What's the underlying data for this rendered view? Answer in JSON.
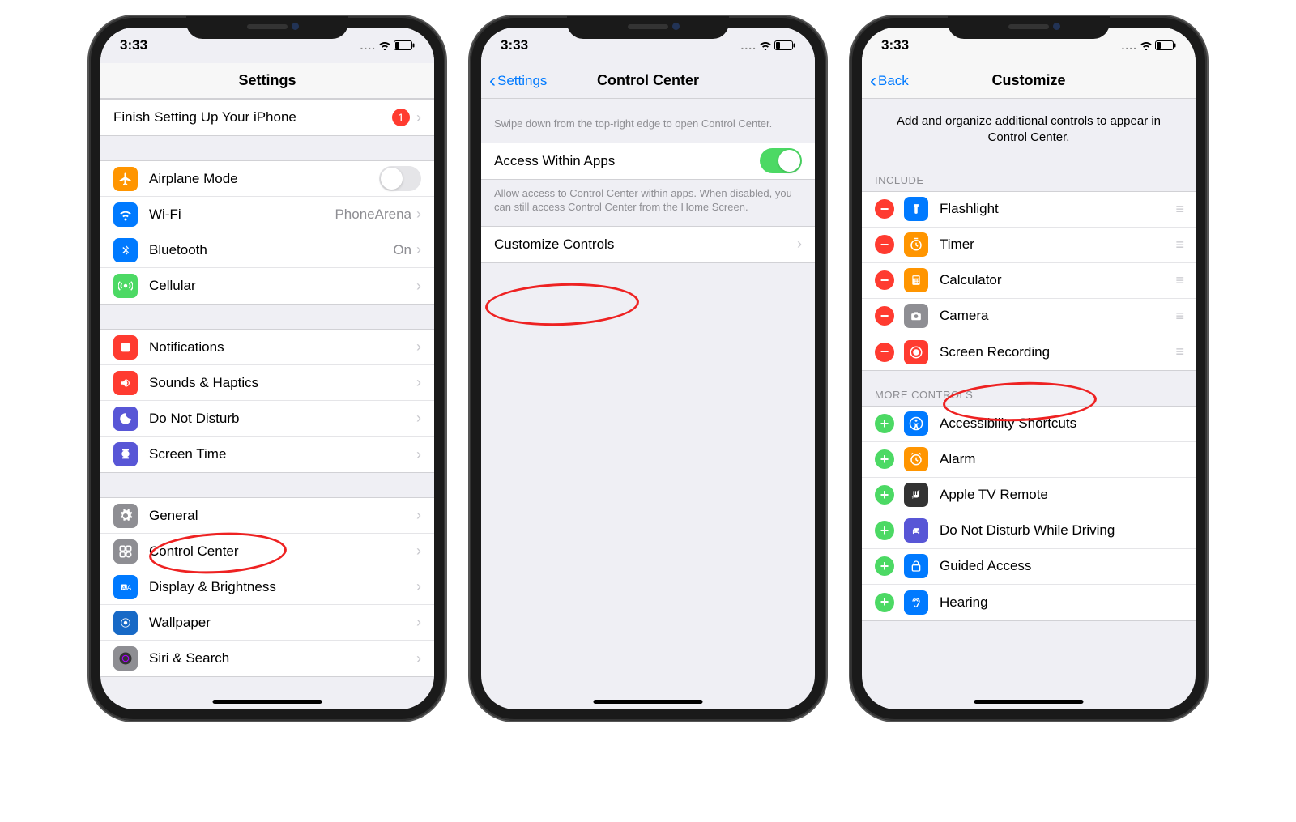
{
  "status": {
    "time": "3:33",
    "dots": "....",
    "wifi": "wifi",
    "battery": "low"
  },
  "screen1": {
    "title": "Settings",
    "setup": {
      "label": "Finish Setting Up Your iPhone",
      "badge": "1"
    },
    "group1": [
      {
        "label": "Airplane Mode",
        "iconBg": "bg-orange",
        "type": "toggle",
        "on": false
      },
      {
        "label": "Wi-Fi",
        "value": "PhoneArena",
        "iconBg": "bg-blue",
        "type": "link"
      },
      {
        "label": "Bluetooth",
        "value": "On",
        "iconBg": "bg-blue",
        "type": "link"
      },
      {
        "label": "Cellular",
        "iconBg": "bg-green",
        "type": "link"
      }
    ],
    "group2": [
      {
        "label": "Notifications",
        "iconBg": "bg-red",
        "type": "link"
      },
      {
        "label": "Sounds & Haptics",
        "iconBg": "bg-red",
        "type": "link"
      },
      {
        "label": "Do Not Disturb",
        "iconBg": "bg-purple",
        "type": "link"
      },
      {
        "label": "Screen Time",
        "iconBg": "bg-purple",
        "type": "link"
      }
    ],
    "group3": [
      {
        "label": "General",
        "iconBg": "bg-gray",
        "type": "link"
      },
      {
        "label": "Control Center",
        "iconBg": "bg-gray",
        "type": "link"
      },
      {
        "label": "Display & Brightness",
        "iconBg": "bg-blue",
        "type": "link"
      },
      {
        "label": "Wallpaper",
        "iconBg": "bg-darkblue",
        "type": "link"
      },
      {
        "label": "Siri & Search",
        "iconBg": "bg-gray",
        "type": "link"
      }
    ]
  },
  "screen2": {
    "back": "Settings",
    "title": "Control Center",
    "help1": "Swipe down from the top-right edge to open Control Center.",
    "access": {
      "label": "Access Within Apps",
      "on": true
    },
    "help2": "Allow access to Control Center within apps. When disabled, you can still access Control Center from the Home Screen.",
    "customize": "Customize Controls"
  },
  "screen3": {
    "back": "Back",
    "title": "Customize",
    "desc": "Add and organize additional controls to appear in Control Center.",
    "includeHeader": "INCLUDE",
    "include": [
      {
        "label": "Flashlight",
        "iconBg": "bg-blue"
      },
      {
        "label": "Timer",
        "iconBg": "bg-orange"
      },
      {
        "label": "Calculator",
        "iconBg": "bg-orange"
      },
      {
        "label": "Camera",
        "iconBg": "bg-gray"
      },
      {
        "label": "Screen Recording",
        "iconBg": "bg-red"
      }
    ],
    "moreHeader": "MORE CONTROLS",
    "more": [
      {
        "label": "Accessibility Shortcuts",
        "iconBg": "bg-blue"
      },
      {
        "label": "Alarm",
        "iconBg": "bg-orange"
      },
      {
        "label": "Apple TV Remote",
        "iconBg": "bg-atv"
      },
      {
        "label": "Do Not Disturb While Driving",
        "iconBg": "bg-purple"
      },
      {
        "label": "Guided Access",
        "iconBg": "bg-blue"
      },
      {
        "label": "Hearing",
        "iconBg": "bg-blue"
      }
    ]
  }
}
